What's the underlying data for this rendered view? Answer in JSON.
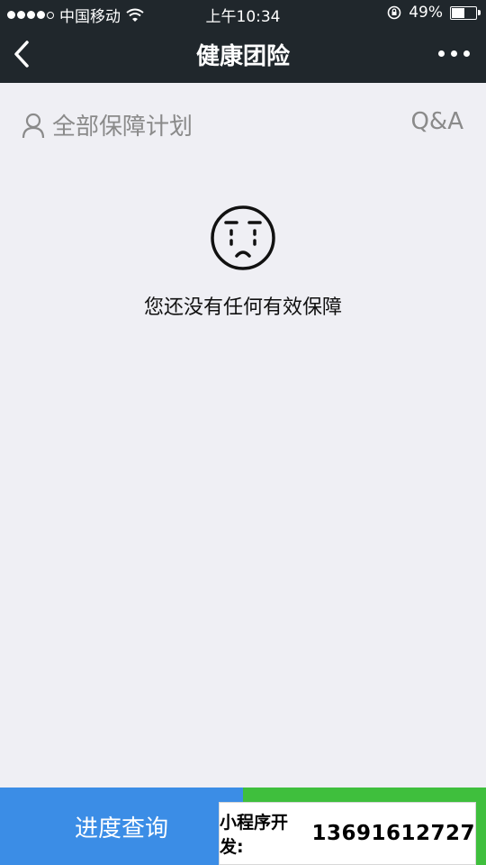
{
  "status_bar": {
    "carrier": "中国移动",
    "time": "上午10:34",
    "battery": "49%",
    "battery_level": 0.49,
    "icons": [
      "signal-dots-icon",
      "wifi-icon",
      "rotation-lock-icon",
      "battery-icon"
    ]
  },
  "nav": {
    "title": "健康团险",
    "icons": [
      "back-arrow-icon",
      "more-dots-icon"
    ]
  },
  "plans": {
    "label": "全部保障计划",
    "qa": "Q&A",
    "icon": "user-icon"
  },
  "empty": {
    "message": "您还没有任何有效保障",
    "icon": "crying-face-icon"
  },
  "bottom": {
    "progress_label": "进度查询"
  },
  "ad": {
    "label": "小程序开发:",
    "phone": "13691612727"
  },
  "colors": {
    "header_bg": "#20272c",
    "page_bg": "#efeff4",
    "blue": "#3b8de6",
    "green": "#3fbf3d"
  }
}
